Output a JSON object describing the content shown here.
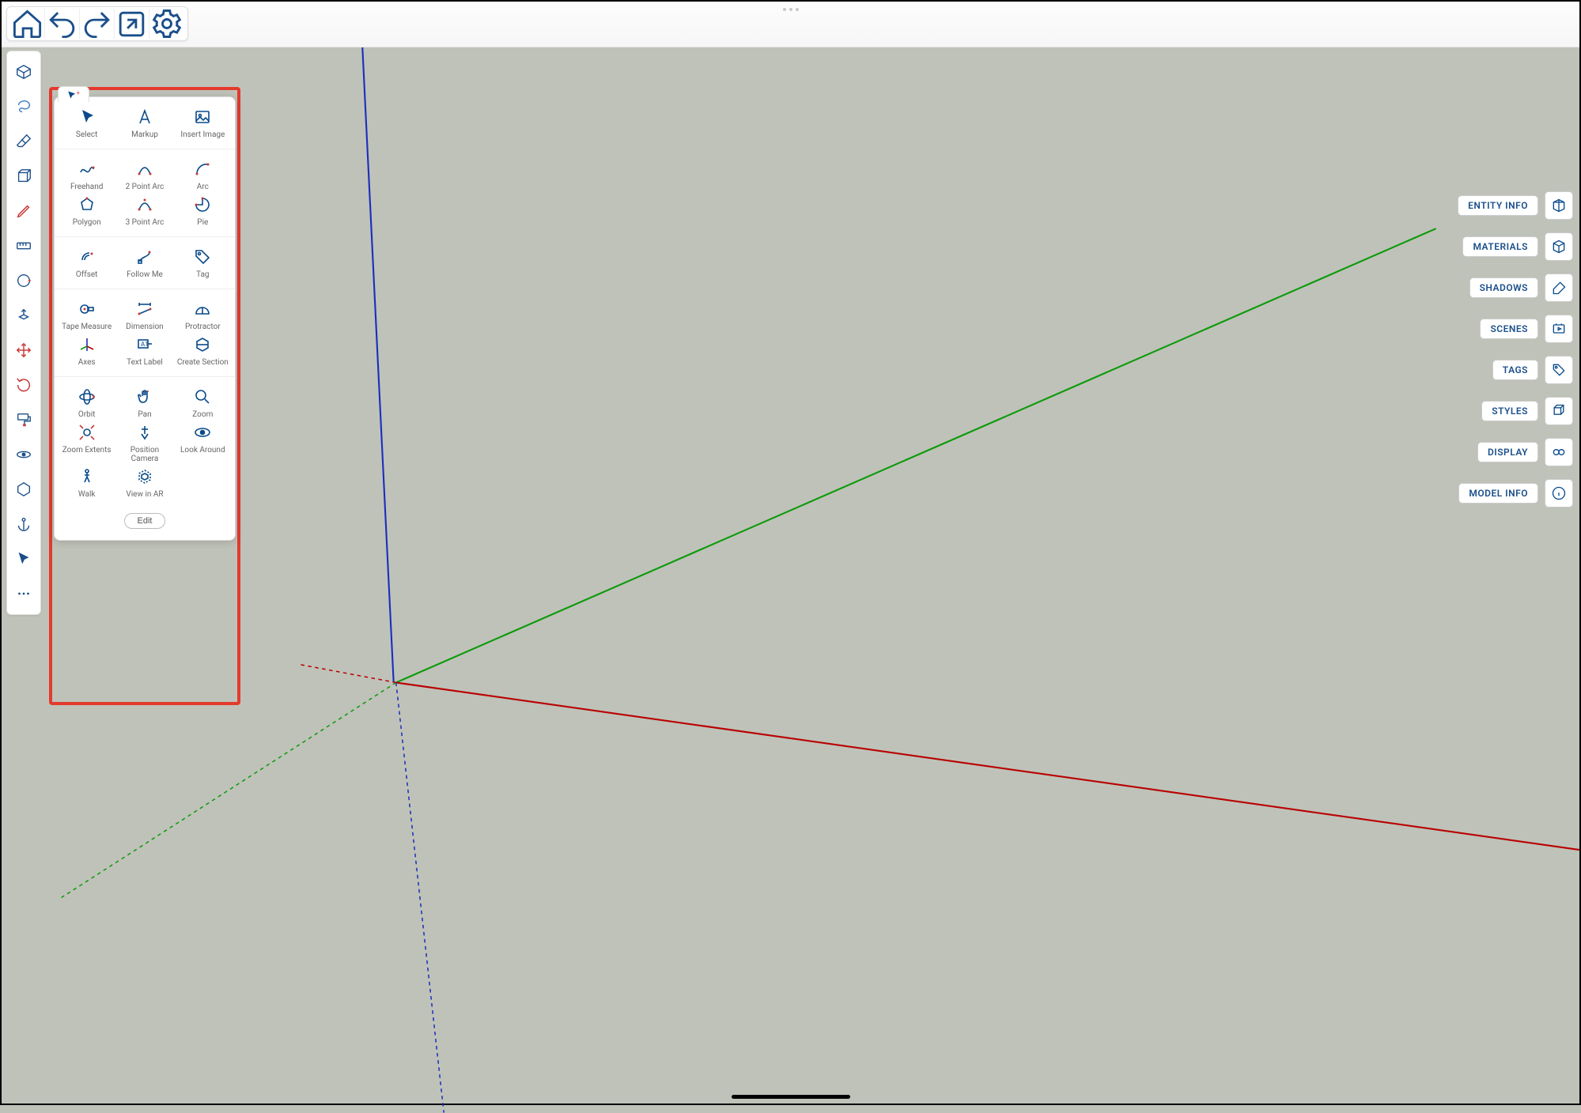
{
  "topToolbar": [
    "home",
    "undo",
    "redo",
    "export",
    "settings"
  ],
  "leftToolbar": [
    {
      "name": "warehouse-icon"
    },
    {
      "name": "lasso-select-icon"
    },
    {
      "name": "eraser-icon"
    },
    {
      "name": "cube-icon"
    },
    {
      "name": "pencil-icon"
    },
    {
      "name": "measure-icon"
    },
    {
      "name": "circle-icon"
    },
    {
      "name": "pushpull-icon"
    },
    {
      "name": "move-icon",
      "accent": true
    },
    {
      "name": "rotate-icon",
      "accent": true
    },
    {
      "name": "paint-icon"
    },
    {
      "name": "orbit-icon"
    },
    {
      "name": "polygon-tool-icon"
    },
    {
      "name": "anchor-icon"
    },
    {
      "name": "select-cursor-icon"
    },
    {
      "name": "more-icon"
    }
  ],
  "palette": {
    "groups": [
      [
        {
          "label": "Select",
          "icon": "cursor-icon"
        },
        {
          "label": "Markup",
          "icon": "markup-icon"
        },
        {
          "label": "Insert Image",
          "icon": "insert-image-icon"
        }
      ],
      [
        {
          "label": "Freehand",
          "icon": "freehand-icon"
        },
        {
          "label": "2 Point Arc",
          "icon": "two-point-arc-icon"
        },
        {
          "label": "Arc",
          "icon": "arc-icon"
        },
        {
          "label": "Polygon",
          "icon": "polygon-icon"
        },
        {
          "label": "3 Point Arc",
          "icon": "three-point-arc-icon"
        },
        {
          "label": "Pie",
          "icon": "pie-icon"
        }
      ],
      [
        {
          "label": "Offset",
          "icon": "offset-icon"
        },
        {
          "label": "Follow Me",
          "icon": "follow-me-icon"
        },
        {
          "label": "Tag",
          "icon": "tag-icon"
        }
      ],
      [
        {
          "label": "Tape Measure",
          "icon": "tape-measure-icon"
        },
        {
          "label": "Dimension",
          "icon": "dimension-icon"
        },
        {
          "label": "Protractor",
          "icon": "protractor-icon"
        },
        {
          "label": "Axes",
          "icon": "axes-icon"
        },
        {
          "label": "Text Label",
          "icon": "text-label-icon"
        },
        {
          "label": "Create Section",
          "icon": "create-section-icon"
        }
      ],
      [
        {
          "label": "Orbit",
          "icon": "orbit-tool-icon"
        },
        {
          "label": "Pan",
          "icon": "pan-icon"
        },
        {
          "label": "Zoom",
          "icon": "zoom-icon"
        },
        {
          "label": "Zoom Extents",
          "icon": "zoom-extents-icon"
        },
        {
          "label": "Position Camera",
          "icon": "position-camera-icon"
        },
        {
          "label": "Look Around",
          "icon": "look-around-icon"
        },
        {
          "label": "Walk",
          "icon": "walk-icon"
        },
        {
          "label": "View in AR",
          "icon": "view-ar-icon"
        }
      ]
    ],
    "editLabel": "Edit"
  },
  "rightPanels": [
    {
      "label": "ENTITY INFO",
      "icon": "entity-info-icon"
    },
    {
      "label": "MATERIALS",
      "icon": "materials-icon"
    },
    {
      "label": "SHADOWS",
      "icon": "shadows-icon"
    },
    {
      "label": "SCENES",
      "icon": "scenes-icon"
    },
    {
      "label": "TAGS",
      "icon": "tags-icon"
    },
    {
      "label": "STYLES",
      "icon": "styles-icon"
    },
    {
      "label": "DISPLAY",
      "icon": "display-icon"
    },
    {
      "label": "MODEL INFO",
      "icon": "model-info-icon"
    }
  ],
  "axes": {
    "blue": "#1a2fbd",
    "green": "#0c9a0c",
    "red": "#b90000",
    "grid": "#8a8a8a"
  }
}
